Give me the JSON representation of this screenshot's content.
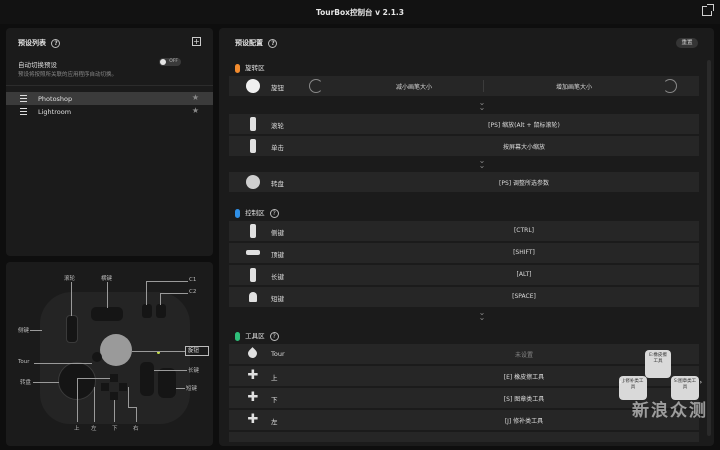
{
  "app": {
    "title": "TourBox控制台 v 2.1.3"
  },
  "presets": {
    "header": "预设列表",
    "help": "?",
    "add": "+",
    "autoswitch_label": "自动切换预设",
    "autoswitch_desc": "预设将按照所关联的应用程序自动切换。",
    "toggle_label": "OFF",
    "items": [
      {
        "name": "Photoshop",
        "star": "★"
      },
      {
        "name": "Lightroom",
        "star": "★"
      }
    ]
  },
  "device": {
    "labels": {
      "knob": "滚轮",
      "tall": "横键",
      "c1": "C1",
      "c2": "C2",
      "side": "侧键",
      "tour": "Tour",
      "dial": "转盘",
      "knob_right": "旋钮",
      "long": "长键",
      "short": "短键",
      "up": "上",
      "left": "左",
      "down": "下",
      "right": "右"
    }
  },
  "config": {
    "header": "预设配置",
    "help": "?",
    "reset": "重置",
    "sections": {
      "rotary": "旋转区",
      "control": "控制区",
      "tools": "工具区"
    },
    "knob_row": {
      "label": "旋钮",
      "left": "减小画笔大小",
      "right": "增加画笔大小"
    },
    "rows_a": [
      {
        "label": "滚轮",
        "value": "[PS] 缩放(Alt + 鼠标滚轮)"
      },
      {
        "label": "单击",
        "value": "按屏幕大小缩放"
      }
    ],
    "dial_row": {
      "label": "转盘",
      "value": "[PS] 调整所选参数"
    },
    "control_rows": [
      {
        "label": "侧键",
        "value": "[CTRL]"
      },
      {
        "label": "顶键",
        "value": "[SHIFT]"
      },
      {
        "label": "长键",
        "value": "[ALT]"
      },
      {
        "label": "短键",
        "value": "[SPACE]"
      }
    ],
    "tool_rows": [
      {
        "label": "Tour",
        "value": "未设置"
      },
      {
        "label": "上",
        "value": "[E] 橡皮擦工具"
      },
      {
        "label": "下",
        "value": "[S] 图章类工具"
      },
      {
        "label": "左",
        "value": "[J] 修补类工具"
      }
    ]
  },
  "overlay": {
    "up": "E:橡皮擦工具",
    "left": "J:修补类工具",
    "right": "S:图章类工具"
  },
  "watermark": {
    "text": "新浪众测"
  },
  "colors": {
    "rotary": "#f28b2e",
    "control": "#2f8fe6",
    "tools": "#2fbf7a"
  }
}
